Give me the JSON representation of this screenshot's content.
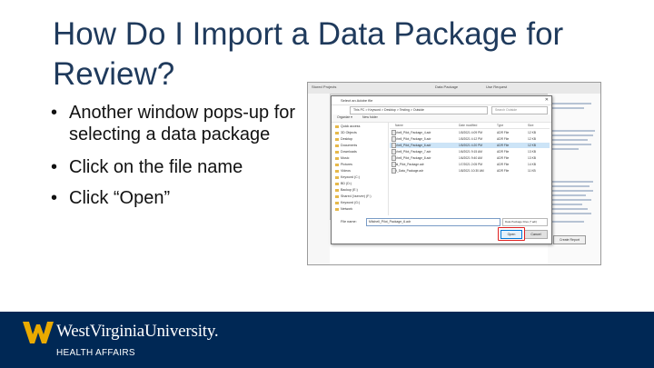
{
  "slide": {
    "title_line1": "How Do I Import a Data Package for",
    "title_line2": "Review?",
    "bullets": [
      "Another window pops-up for selecting a data package",
      "Click on the file name",
      "Click “Open”"
    ]
  },
  "screenshot": {
    "app_tabs": [
      "Stored Projects",
      "Data Package",
      "Use Request"
    ],
    "dialog": {
      "title": "Select an Adobe file",
      "address": "This PC > Keyword > Desktop > Testing > Outside",
      "search_placeholder": "Search Outside",
      "toolbar": [
        "Organize ▾",
        "New folder"
      ],
      "nav_items": [
        "Quick access",
        "3D Objects",
        "Desktop",
        "Documents",
        "Downloads",
        "Music",
        "Pictures",
        "Videos",
        "Keyword (C:)",
        "BD (D:)",
        "Backup (E:)",
        "Shared (\\\\server) (F:)",
        "Keyword (G:)",
        "Network"
      ],
      "columns": [
        "Name",
        "Date modified",
        "Type",
        "Size"
      ],
      "files": [
        {
          "name": "Mitchell_Pilot_Package_4.adr",
          "date": "1/5/2021 4:09 PM",
          "type": "ADR File",
          "size": "12 KB",
          "selected": false
        },
        {
          "name": "Mitchell_Pilot_Package_5.adr",
          "date": "1/5/2021 4:12 PM",
          "type": "ADR File",
          "size": "12 KB",
          "selected": false
        },
        {
          "name": "Mitchell_Pilot_Package_6.adr",
          "date": "1/5/2021 4:20 PM",
          "type": "ADR File",
          "size": "12 KB",
          "selected": true
        },
        {
          "name": "Mitchell_Pilot_Package_7.adr",
          "date": "1/6/2021 9:15 AM",
          "type": "ADR File",
          "size": "13 KB",
          "selected": false
        },
        {
          "name": "Mitchell_Pilot_Package_8.adr",
          "date": "1/6/2021 9:40 AM",
          "type": "ADR File",
          "size": "13 KB",
          "selected": false
        },
        {
          "name": "Final_Pilot_Package.adr",
          "date": "1/7/2021 2:05 PM",
          "type": "ADR File",
          "size": "14 KB",
          "selected": false
        },
        {
          "name": "Test_Data_Package.adr",
          "date": "1/8/2021 10:30 AM",
          "type": "ADR File",
          "size": "11 KB",
          "selected": false
        }
      ],
      "filename_label": "File name:",
      "filename_value": "Mitchell_Pilot_Package_6.adr",
      "filetype_value": "Data Package Files (*.adr)",
      "open_label": "Open",
      "cancel_label": "Cancel"
    },
    "panel_buttons": [
      "Create Request",
      "Create Report"
    ]
  },
  "footer": {
    "brand": "WestVirginiaUniversity.",
    "subtitle": "HEALTH AFFAIRS"
  },
  "colors": {
    "title": "#1f3a5c",
    "footer_bg": "#002855",
    "logo_gold": "#eaaa00",
    "highlight": "#e02020"
  }
}
